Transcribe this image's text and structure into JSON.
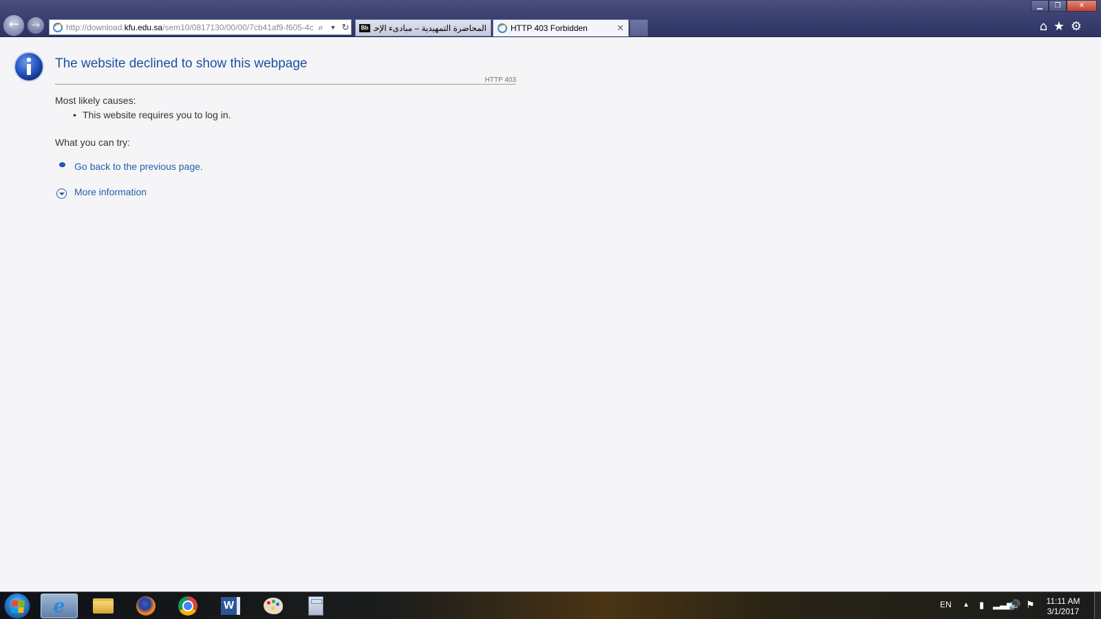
{
  "browser": {
    "address": {
      "url_prefix": "http://download.",
      "url_host": "kfu.edu.sa",
      "url_path": "/sem10/0817130/00/00/7cb41af9-f605-4c"
    },
    "tabs": [
      {
        "label": "المحاضرة التمهيدية – مبادىء الإحص...",
        "icon": "Bb"
      },
      {
        "label": "HTTP 403 Forbidden",
        "close": "✕"
      }
    ],
    "toolbar": {
      "home_icon": "⌂",
      "favorites_icon": "★",
      "settings_icon": "⚙"
    },
    "window": {
      "minimize": "▁",
      "restore": "❐",
      "close": "✕"
    }
  },
  "page": {
    "title": "The website declined to show this webpage",
    "http_code": "HTTP 403",
    "causes_heading": "Most likely causes:",
    "causes": [
      "This website requires you to log in."
    ],
    "try_heading": "What you can try:",
    "back_link": "Go back to the previous page.",
    "more_info": "More information"
  },
  "taskbar": {
    "apps": [
      "Internet Explorer",
      "Windows Explorer",
      "Firefox",
      "Chrome",
      "Word",
      "Paint",
      "Calculator"
    ],
    "tray": {
      "language": "EN",
      "time": "11:11 AM",
      "date": "3/1/2017"
    }
  },
  "colors": {
    "link": "#1f5fad",
    "title": "#1f4fa0",
    "chrome_bg": "#3b4170"
  }
}
